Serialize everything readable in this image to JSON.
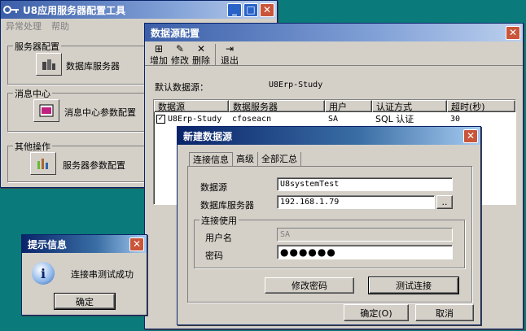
{
  "main_window": {
    "title": "U8应用服务器配置工具",
    "menu": [
      "异常处理",
      "帮助"
    ],
    "sections": [
      {
        "group": "服务器配置",
        "item": "数据库服务器",
        "icon": "database-server-icon"
      },
      {
        "group": "消息中心",
        "item": "消息中心参数配置",
        "icon": "message-center-icon"
      },
      {
        "group": "其他操作",
        "item": "服务器参数配置",
        "icon": "server-params-icon"
      }
    ]
  },
  "ds_window": {
    "title": "数据源配置",
    "toolbar": {
      "add": "增加",
      "edit": "修改",
      "delete": "删除",
      "exit": "退出"
    },
    "default_label": "默认数据源：",
    "default_value": "U8Erp-Study",
    "columns": [
      "数据源",
      "数据服务器",
      "用户",
      "认证方式",
      "超时(秒)"
    ],
    "rows": [
      {
        "name": "U8Erp-Study",
        "server": "cfoseacn",
        "user": "SA",
        "auth": "SQL 认证",
        "timeout": "30"
      }
    ]
  },
  "new_ds": {
    "title": "新建数据源",
    "tabs": [
      "连接信息",
      "高级",
      "全部汇总"
    ],
    "ds_label": "数据源",
    "ds_value": "U8systemTest",
    "server_label": "数据库服务器",
    "server_value": "192.168.1.79",
    "browse": "..",
    "conn_group": "连接使用",
    "user_label": "用户名",
    "user_value": "SA",
    "pwd_label": "密码",
    "pwd_value": "●●●●●●",
    "change_pwd": "修改密码",
    "test_conn": "测试连接",
    "ok": "确定(O)",
    "cancel": "取消"
  },
  "msgbox": {
    "title": "提示信息",
    "message": "连接串测试成功",
    "ok": "确定"
  }
}
